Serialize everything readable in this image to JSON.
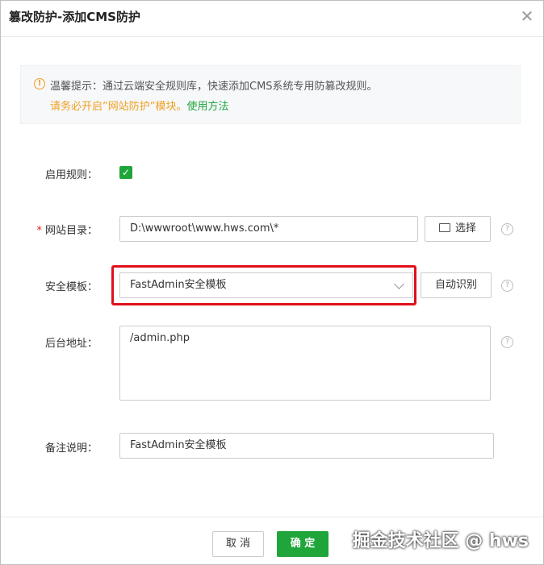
{
  "dialog": {
    "title": "篡改防护-添加CMS防护",
    "close_glyph": "✕"
  },
  "tip": {
    "line1": "温馨提示：通过云端安全规则库，快速添加CMS系统专用防篡改规则。",
    "line2_prefix": "请务必开启”网站防护”模块。",
    "line2_link": "使用方法"
  },
  "form": {
    "enable_label": "启用规则：",
    "enable_checked": true,
    "site_dir_label": "网站目录：",
    "site_dir_required_mark": "*",
    "site_dir_value": "D:\\wwwroot\\www.hws.com\\*",
    "select_button": "选择",
    "template_label": "安全模板：",
    "template_value": "FastAdmin安全模板",
    "auto_detect_button": "自动识别",
    "admin_label": "后台地址：",
    "admin_value": "/admin.php",
    "remark_label": "备注说明：",
    "remark_value": "FastAdmin安全模板",
    "help_glyph": "?"
  },
  "footer": {
    "cancel": "取 消",
    "confirm": "确 定"
  },
  "watermark": "掘金技术社区 @ hws",
  "colors": {
    "accent": "#20a53a",
    "warning": "#f0a020",
    "highlight": "#e0101a"
  }
}
